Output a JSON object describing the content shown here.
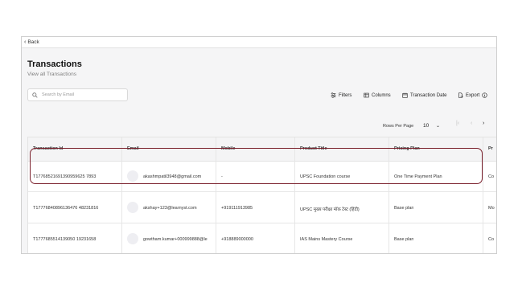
{
  "back": {
    "label": "Back"
  },
  "page": {
    "title": "Transactions",
    "subtitle": "View all Transactions"
  },
  "search": {
    "placeholder": "Search by Email"
  },
  "toolbar": {
    "filters": "Filters",
    "columns": "Columns",
    "transaction_date": "Transaction Date",
    "export": "Export"
  },
  "pagination": {
    "rows_per_page_label": "Rows Per Page",
    "rows_per_page_value": "10"
  },
  "table": {
    "columns": [
      "Transaction Id",
      "Email",
      "Mobile",
      "Product Title",
      "Pricing Plan",
      "Pr"
    ],
    "rows": [
      {
        "transaction_id": "T17768521691390959625 7893",
        "email": "akashmpatil3948@gmail.com",
        "mobile": "-",
        "product_title": "UPSC Foundation course",
        "pricing_plan": "One Time Payment Plan",
        "extra": "Co"
      },
      {
        "transaction_id": "T17776840896136476 48231816",
        "email": "akshay+123@learnyst.com",
        "mobile": "+919111913985",
        "product_title": "UPSC मुख्य परीक्षा मॉक टेस्ट (हिंदी)",
        "pricing_plan": "Base plan",
        "extra": "Mo"
      },
      {
        "transaction_id": "T1777685514139050 19231658",
        "email": "gowtham.kumar+000999888@le",
        "mobile": "+918889000000",
        "product_title": "IAS Mains Mastery Course",
        "pricing_plan": "Base plan",
        "extra": "Co"
      }
    ]
  }
}
